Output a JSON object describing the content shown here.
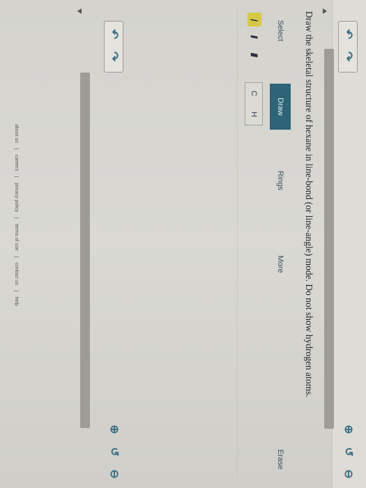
{
  "question": {
    "text": "Draw the skeletal structure of hexane in line-bond (or line-angle) mode. Do not show hydrogen atoms."
  },
  "tabs": {
    "select": "Select",
    "draw": "Draw",
    "rings": "Rings",
    "more": "More",
    "erase": "Erase"
  },
  "bond_tools": {
    "single": "/",
    "double": "//",
    "triple": "///"
  },
  "atoms": {
    "carbon": "C",
    "hydrogen": "H"
  },
  "undo_redo": {
    "undo": "↶",
    "redo": "↷"
  },
  "zoom": {
    "zoom_in": "⊕",
    "reset": "↺",
    "zoom_out": "⊖"
  },
  "footer": {
    "about": "about us",
    "careers": "careers",
    "privacy": "privacy policy",
    "terms": "terms of use",
    "contact": "contact us",
    "help": "help"
  },
  "colors": {
    "accent": "#2d6477",
    "active_tool": "#d6c948"
  }
}
